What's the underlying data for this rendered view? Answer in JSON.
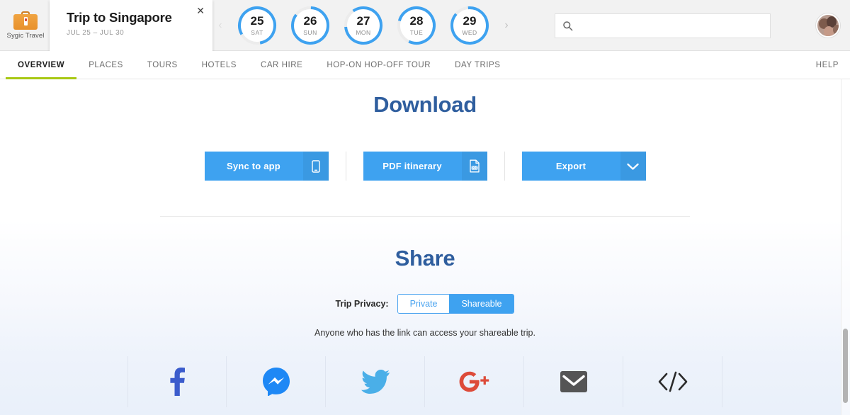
{
  "brand": {
    "label": "Sygic Travel",
    "icon": "suitcase-icon"
  },
  "trip_card": {
    "title": "Trip to Singapore",
    "dates": "JUL 25 – JUL 30",
    "close_label": "✕"
  },
  "day_strip": {
    "prev_arrow": "›",
    "next_arrow": "›",
    "days": [
      {
        "num": "25",
        "dow": "SAT",
        "ring_gap_deg": 70,
        "ring_rotate_deg": 150
      },
      {
        "num": "26",
        "dow": "SUN",
        "ring_gap_deg": 55,
        "ring_rotate_deg": 272
      },
      {
        "num": "27",
        "dow": "MON",
        "ring_gap_deg": 60,
        "ring_rotate_deg": 235
      },
      {
        "num": "28",
        "dow": "TUE",
        "ring_gap_deg": 80,
        "ring_rotate_deg": 195
      },
      {
        "num": "29",
        "dow": "WED",
        "ring_gap_deg": 45,
        "ring_rotate_deg": 265
      }
    ]
  },
  "search": {
    "placeholder": "",
    "value": "",
    "icon": "search-icon"
  },
  "avatar": {
    "name": "user-avatar"
  },
  "nav": {
    "tabs": [
      {
        "label": "OVERVIEW",
        "active": true
      },
      {
        "label": "PLACES",
        "active": false
      },
      {
        "label": "TOURS",
        "active": false
      },
      {
        "label": "HOTELS",
        "active": false
      },
      {
        "label": "CAR HIRE",
        "active": false
      },
      {
        "label": "HOP-ON HOP-OFF TOUR",
        "active": false
      },
      {
        "label": "DAY TRIPS",
        "active": false
      }
    ],
    "help_label": "HELP",
    "active_underline_color": "#a8c813"
  },
  "download": {
    "title": "Download",
    "buttons": [
      {
        "label": "Sync to app",
        "icon": "mobile-phone-icon"
      },
      {
        "label": "PDF itinerary",
        "icon": "pdf-document-icon"
      },
      {
        "label": "Export",
        "icon": "chevron-down-icon"
      }
    ]
  },
  "share": {
    "title": "Share",
    "privacy_label": "Trip Privacy:",
    "privacy_options": [
      {
        "label": "Private",
        "active": false
      },
      {
        "label": "Shareable",
        "active": true
      }
    ],
    "note": "Anyone who has the link can access your shareable trip.",
    "social": [
      {
        "name": "facebook-icon",
        "color": "#3b5ccc"
      },
      {
        "name": "messenger-icon",
        "color": "#1e88f5"
      },
      {
        "name": "twitter-icon",
        "color": "#4aafe8"
      },
      {
        "name": "google-plus-icon",
        "color": "#dd4b39"
      },
      {
        "name": "email-icon",
        "color": "#555555"
      },
      {
        "name": "embed-code-icon",
        "color": "#2b2b2b"
      }
    ]
  },
  "colors": {
    "accent_blue": "#3ea2f0",
    "heading_blue": "#2f5e9e",
    "nav_active_green": "#a8c813",
    "brand_orange": "#e8912c"
  }
}
